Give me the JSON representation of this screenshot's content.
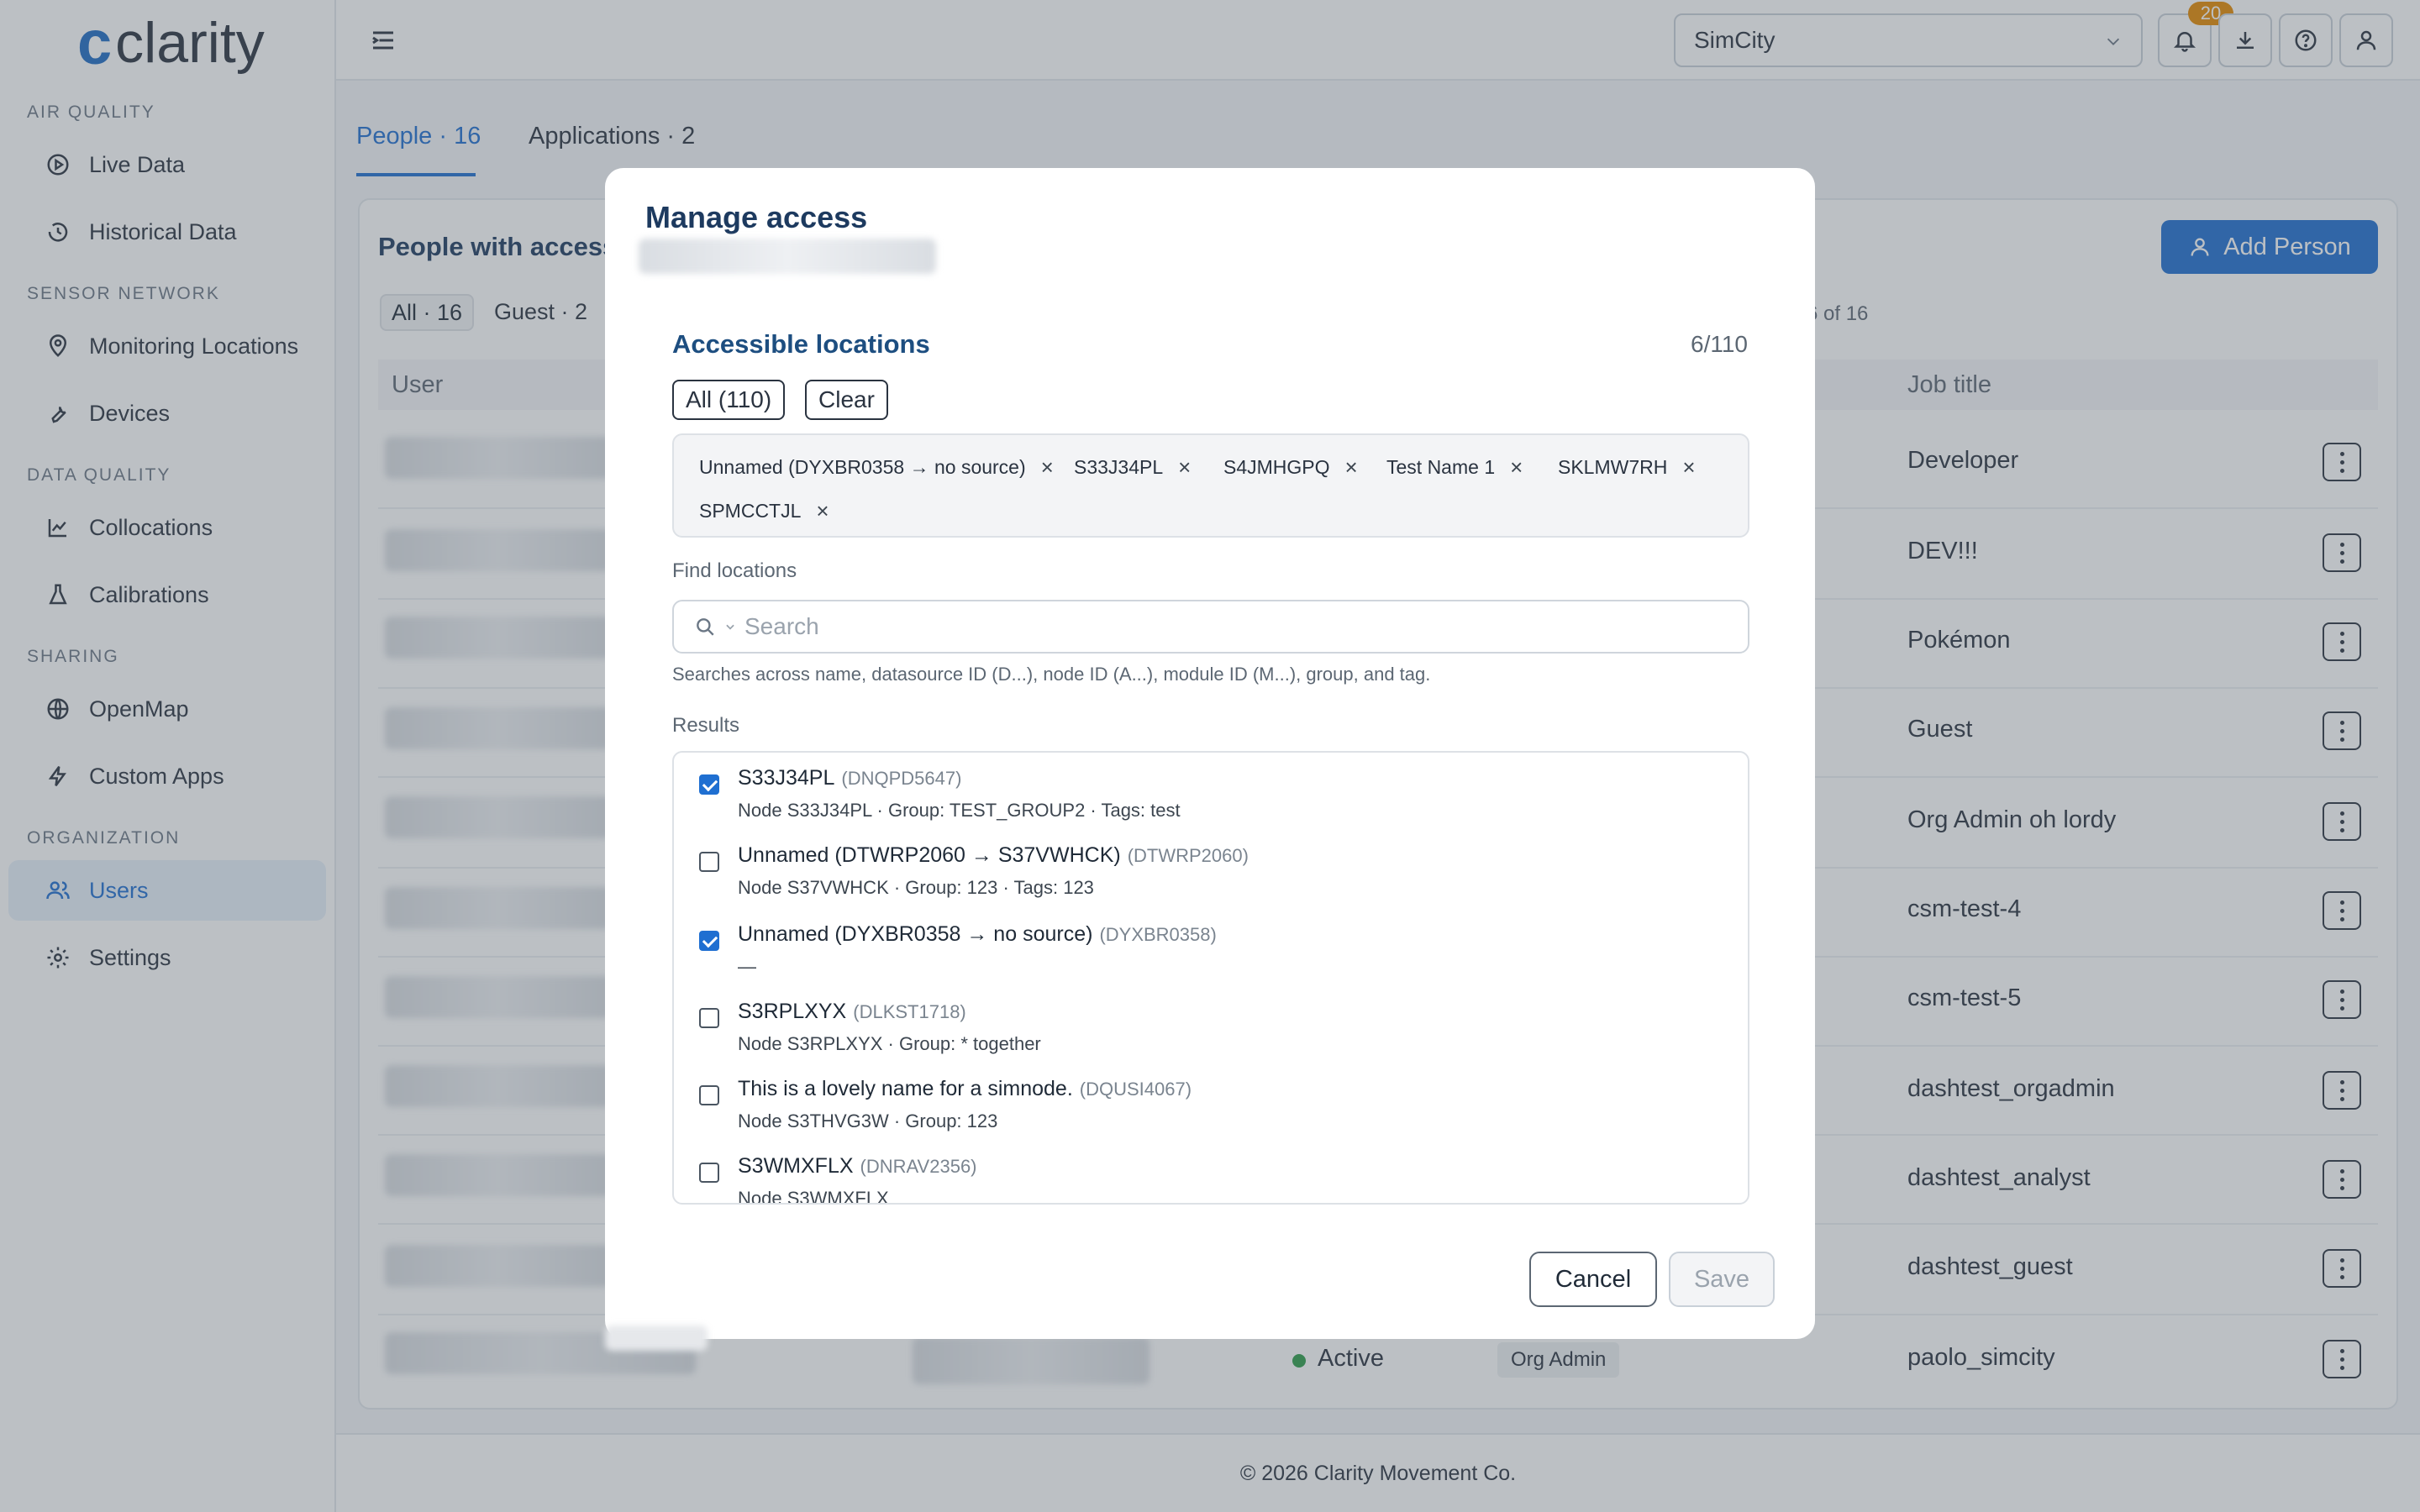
{
  "app": {
    "logo_mark": "c",
    "logo_text": "clarity"
  },
  "sidebar": {
    "sections": [
      {
        "title": "AIR QUALITY"
      },
      {
        "title": "SENSOR NETWORK"
      },
      {
        "title": "DATA QUALITY"
      },
      {
        "title": "SHARING"
      },
      {
        "title": "ORGANIZATION"
      }
    ],
    "items": [
      {
        "label": "Live Data",
        "icon": "play-circle-icon"
      },
      {
        "label": "Historical Data",
        "icon": "history-icon"
      },
      {
        "label": "Monitoring Locations",
        "icon": "location-pin-icon"
      },
      {
        "label": "Devices",
        "icon": "wrench-icon"
      },
      {
        "label": "Collocations",
        "icon": "line-chart-icon"
      },
      {
        "label": "Calibrations",
        "icon": "flask-icon"
      },
      {
        "label": "OpenMap",
        "icon": "globe-icon"
      },
      {
        "label": "Custom Apps",
        "icon": "lightning-icon"
      },
      {
        "label": "Users",
        "icon": "users-icon",
        "active": true
      },
      {
        "label": "Settings",
        "icon": "gear-icon"
      }
    ]
  },
  "topbar": {
    "org_select": "SimCity",
    "notification_count": "20"
  },
  "tabs": [
    {
      "label": "People · 16",
      "active": true
    },
    {
      "label": "Applications · 2"
    }
  ],
  "people": {
    "title": "People with access",
    "add_button": "Add Person",
    "filters": [
      "All · 16",
      "Guest · 2"
    ],
    "pagination": "6 of 16",
    "columns": {
      "user": "User",
      "job_title": "Job title"
    },
    "job_titles": [
      "Developer",
      "DEV!!!",
      "Pokémon",
      "Guest",
      "Org Admin oh lordy",
      "csm-test-4",
      "csm-test-5",
      "dashtest_orgadmin",
      "dashtest_analyst",
      "dashtest_guest",
      "paolo_simcity"
    ],
    "last_row": {
      "status": "Active",
      "role": "Org Admin"
    }
  },
  "footer": {
    "text": "© 2026 Clarity Movement Co."
  },
  "modal": {
    "title": "Manage access",
    "section_title": "Accessible locations",
    "count": "6/110",
    "all_button": "All (110)",
    "clear_button": "Clear",
    "selected_chips": [
      "Unnamed (DYXBR0358 → no source)",
      "S33J34PL",
      "S4JMHGPQ",
      "Test Name 1",
      "SKLMW7RH",
      "SPMCCTJL"
    ],
    "find_label": "Find locations",
    "search_placeholder": "Search",
    "search_help": "Searches across name, datasource ID (D...), node ID (A...), module ID (M...), group, and tag.",
    "results_label": "Results",
    "results": [
      {
        "name": "S33J34PL",
        "code": "(DNQPD5647)",
        "sub": "Node S33J34PL · Group: TEST_GROUP2 · Tags: test",
        "checked": true
      },
      {
        "name": "Unnamed (DTWRP2060 → S37VWHCK)",
        "code": "(DTWRP2060)",
        "sub": "Node S37VWHCK · Group: 123 · Tags: 123",
        "checked": false
      },
      {
        "name": "Unnamed (DYXBR0358 → no source)",
        "code": "(DYXBR0358)",
        "sub": "—",
        "checked": true
      },
      {
        "name": "S3RPLXYX",
        "code": "(DLKST1718)",
        "sub": "Node S3RPLXYX · Group: * together",
        "checked": false
      },
      {
        "name": "This is a lovely name for a simnode.",
        "code": "(DQUSI4067)",
        "sub": "Node S3THVG3W · Group: 123",
        "checked": false
      },
      {
        "name": "S3WMXFLX",
        "code": "(DNRAV2356)",
        "sub": "Node S3WMXFLX",
        "checked": false
      }
    ],
    "cancel_button": "Cancel",
    "save_button": "Save"
  }
}
